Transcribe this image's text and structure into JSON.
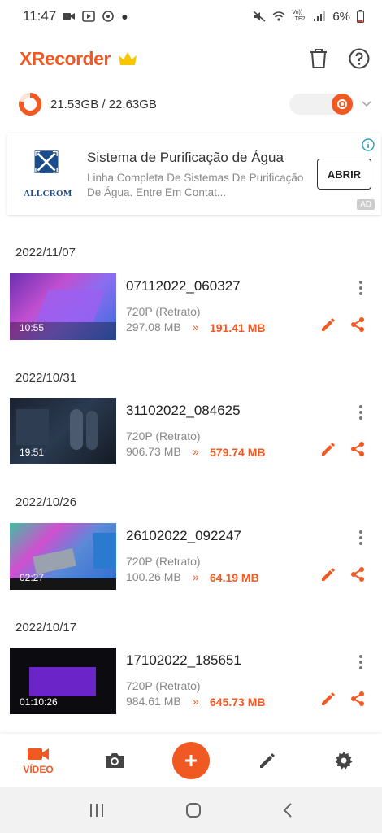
{
  "status_bar": {
    "time": "11:47",
    "carrier_tag": "Vo)) LTE2",
    "battery": "6%"
  },
  "app": {
    "logo_x": "X",
    "logo_rest": "Recorder"
  },
  "storage": {
    "usage": "21.53GB / 22.63GB"
  },
  "ad": {
    "brand": "ALLCROM",
    "title": "Sistema de Purificação de Água",
    "description": "Linha Completa De Sistemas De Purificação De Água. Entre Em Contat...",
    "cta": "ABRIR",
    "tag": "AD"
  },
  "recordings": [
    {
      "date": "2022/11/07",
      "name": "07112022_060327",
      "resolution": "720P (Retrato)",
      "size": "297.08 MB",
      "compressed": "191.41 MB",
      "duration": "10:55"
    },
    {
      "date": "2022/10/31",
      "name": "31102022_084625",
      "resolution": "720P (Retrato)",
      "size": "906.73 MB",
      "compressed": "579.74 MB",
      "duration": "19:51"
    },
    {
      "date": "2022/10/26",
      "name": "26102022_092247",
      "resolution": "720P (Retrato)",
      "size": "100.26 MB",
      "compressed": "64.19 MB",
      "duration": "02:27"
    },
    {
      "date": "2022/10/17",
      "name": "17102022_185651",
      "resolution": "720P (Retrato)",
      "size": "984.61 MB",
      "compressed": "645.73 MB",
      "duration": "01:10:26"
    }
  ],
  "compress_arrow": "»",
  "bottom_nav": {
    "video_label": "VÍDEO"
  },
  "colors": {
    "accent": "#f05a22",
    "crown": "#f7c600"
  }
}
